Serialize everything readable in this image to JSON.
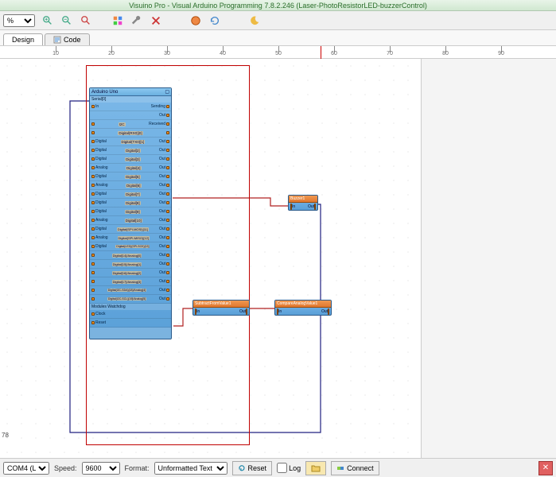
{
  "title": "Visuino Pro - Visual Arduino Programming 7.8.2.246 (Laser-PhotoResistorLED-buzzerControl)",
  "toolbar": {
    "zoom": "%"
  },
  "tabs": {
    "design": "Design",
    "code": "Code"
  },
  "ruler": {
    "marks": [
      10,
      20,
      30,
      40,
      50,
      60,
      70,
      80,
      90
    ]
  },
  "status": {
    "coord": "78"
  },
  "arduino": {
    "title": "Arduino Uno",
    "serial_label": "Serial[0]",
    "sending": "Sending",
    "out": "Out",
    "in": "In",
    "ic": "I2C",
    "received": "Received",
    "digital_rx0": "Digital(RX0)[0]",
    "digital_tx0": "Digital(TX0)[1]",
    "pins": [
      {
        "l": "Digital",
        "m": "Digital[2]",
        "o": "Out"
      },
      {
        "l": "Digital",
        "m": "Digital[3]",
        "o": "Out"
      },
      {
        "l": "Analog",
        "m": "Digital[4]",
        "o": "Out"
      },
      {
        "l": "Digital",
        "m": "Digital[5]",
        "o": "Out"
      },
      {
        "l": "Analog",
        "m": "Digital[6]",
        "o": "Out"
      },
      {
        "l": "Digital",
        "m": "Digital[7]",
        "o": "Out"
      },
      {
        "l": "Digital",
        "m": "Digital[8]",
        "o": "Out"
      },
      {
        "l": "Digital",
        "m": "Digital[9]",
        "o": "Out"
      },
      {
        "l": "Analog",
        "m": "Digital[10]",
        "o": "Out"
      },
      {
        "l": "Digital",
        "m": "Digital(SPI-MOSI)[11]",
        "o": "Out"
      },
      {
        "l": "Analog",
        "m": "Digital(SPI-MISO)[12]",
        "o": "Out"
      },
      {
        "l": "Digital",
        "m": "Digital(LED)(SPI-SCK)[13]",
        "o": "Out"
      },
      {
        "l": "",
        "m": "Digital[14]/Analog[0]",
        "o": "Out"
      },
      {
        "l": "",
        "m": "Digital[15]/Analog[1]",
        "o": "Out"
      },
      {
        "l": "",
        "m": "Digital[16]/Analog[2]",
        "o": "Out"
      },
      {
        "l": "",
        "m": "Digital[17]/Analog[3]",
        "o": "Out"
      },
      {
        "l": "",
        "m": "Digital(I2C-SDA)[18]/Analog[4]",
        "o": "Out"
      },
      {
        "l": "",
        "m": "Digital(I2C-SCL)[19]/Analog[5]",
        "o": "Out"
      }
    ],
    "watchdog": "Modules Watchdog",
    "clock": "Clock",
    "reset": "Reset"
  },
  "blocks": {
    "buzzer": {
      "title": "Buzzer1",
      "in": "In",
      "out": "Out"
    },
    "subtract": {
      "title": "SubtractFromValue1",
      "in": "In",
      "out": "Out"
    },
    "compare": {
      "title": "CompareAnalogValue1",
      "in": "In",
      "out": "Out"
    }
  },
  "bottom": {
    "port": "COM4 (L",
    "speed_label": "Speed:",
    "speed": "9600",
    "format_label": "Format:",
    "format": "Unformatted Text",
    "reset": "Reset",
    "log": "Log",
    "connect": "Connect"
  }
}
